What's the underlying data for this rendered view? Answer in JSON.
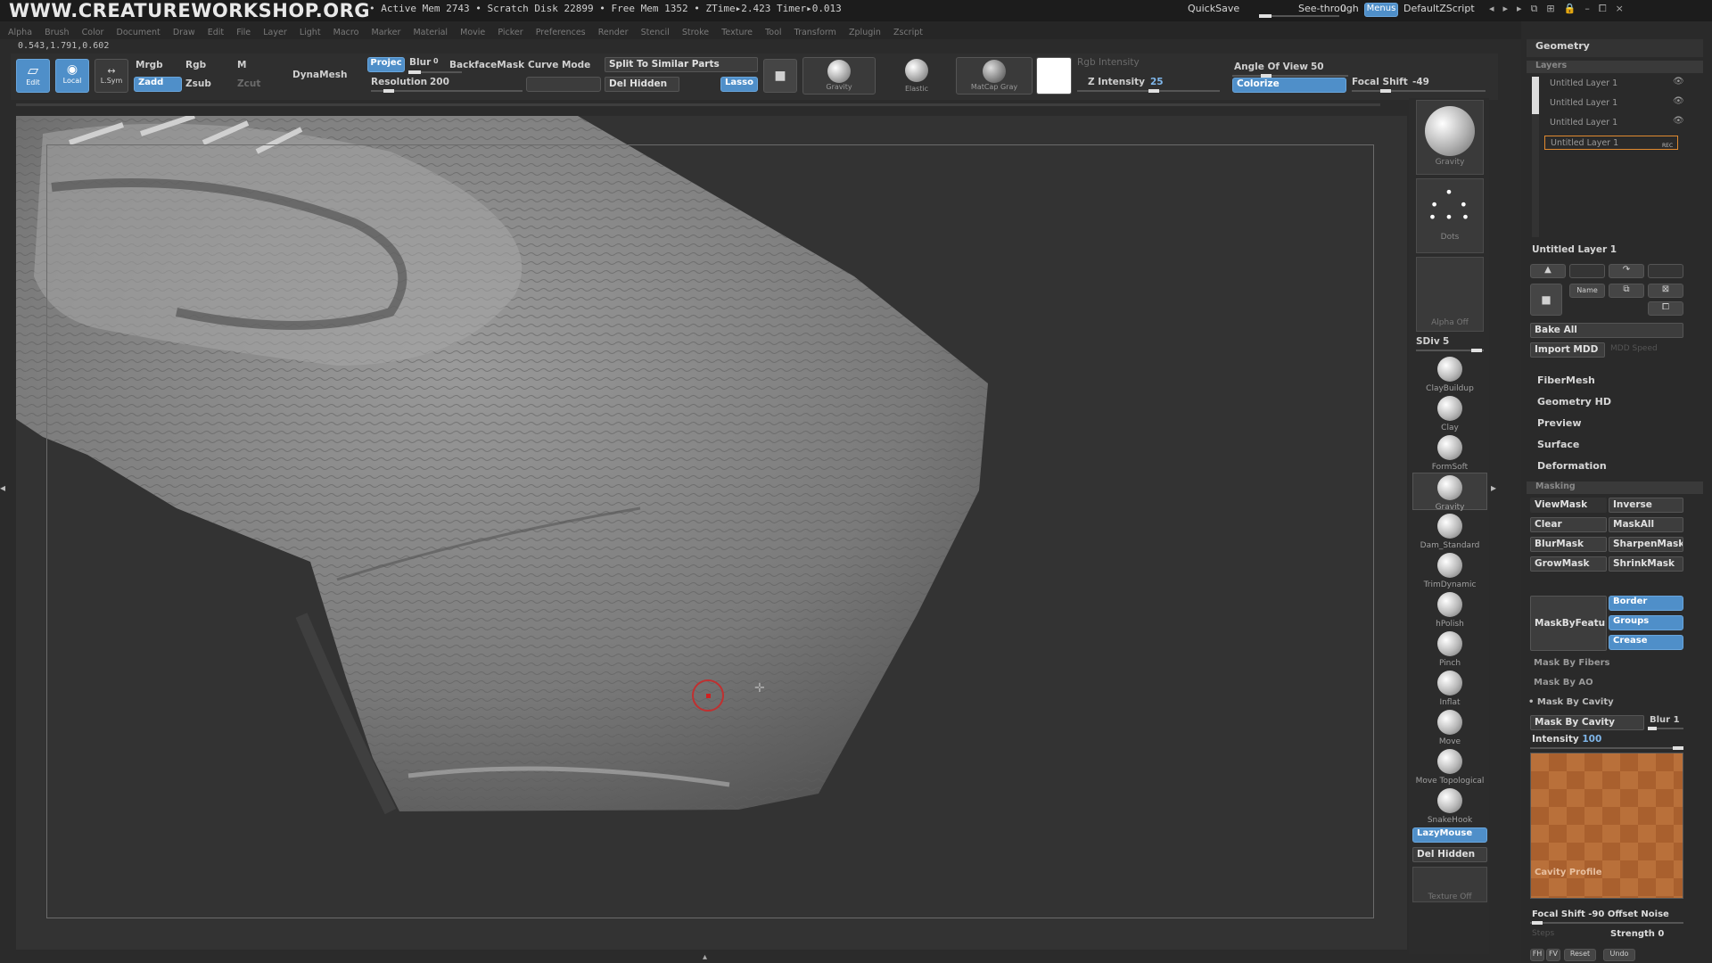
{
  "header": {
    "site": "WWW.CREATUREWORKSHOP.ORG",
    "stats": "• Active Mem 2743 • Scratch Disk 22899 • Free Mem 1352 • ZTime▸2.423 Timer▸0.013",
    "quicksave": "QuickSave",
    "see_through": "See-through",
    "see_through_value": "0",
    "menus": "Menus",
    "script": "DefaultZScript"
  },
  "menubar": [
    "Alpha",
    "Brush",
    "Color",
    "Document",
    "Draw",
    "Edit",
    "File",
    "Layer",
    "Light",
    "Macro",
    "Marker",
    "Material",
    "Movie",
    "Picker",
    "Preferences",
    "Render",
    "Stencil",
    "Stroke",
    "Texture",
    "Tool",
    "Transform",
    "Zplugin",
    "Zscript"
  ],
  "coords": "0.543,1.791,0.602",
  "toolbar": {
    "edit": "Edit",
    "local": "Local",
    "lsym": "L.Sym",
    "mrgb": "Mrgb",
    "rgb": "Rgb",
    "m": "M",
    "zadd": "Zadd",
    "zsub": "Zsub",
    "zcut": "Zcut",
    "dynamesh": "DynaMesh",
    "projec": "Projec",
    "blur": "Blur",
    "blur_value": "0",
    "backfacemask": "BackfaceMask",
    "curve_mode": "Curve Mode",
    "resolution": "Resolution",
    "resolution_value": "200",
    "split": "Split To Similar Parts",
    "del_hidden": "Del Hidden",
    "lasso": "Lasso",
    "gravity": "Gravity",
    "elastic": "Elastic",
    "matcap": "MatCap Gray",
    "rgb_intensity": "Rgb Intensity",
    "z_intensity": "Z Intensity",
    "z_intensity_value": "25",
    "angle_of_view": "Angle Of View",
    "angle_value": "50",
    "colorize": "Colorize",
    "focal_shift": "Focal Shift",
    "focal_value": "-49"
  },
  "right_shelf": {
    "gravity": "Gravity",
    "dots": "Dots",
    "alpha_off": "Alpha Off",
    "sdiv": "SDiv",
    "sdiv_value": "5",
    "brushes": [
      "ClayBuildup",
      "Clay",
      "FormSoft",
      "Gravity",
      "Dam_Standard",
      "TrimDynamic",
      "hPolish",
      "Pinch",
      "Inflat",
      "Move",
      "Move Topological",
      "SnakeHook"
    ],
    "lazymouse": "LazyMouse",
    "del_hidden": "Del Hidden",
    "texture_off": "Texture Off"
  },
  "panel": {
    "geometry": "Geometry",
    "layers": "Layers",
    "layer_items": [
      "Untitled Layer 1",
      "Untitled Layer 1",
      "Untitled Layer 1",
      "Untitled Layer 1"
    ],
    "rec": "REC",
    "current_layer": "Untitled Layer 1",
    "name": "Name",
    "bake_all": "Bake All",
    "import_mdd": "Import MDD",
    "mdd_speed": "MDD Speed",
    "sections": [
      "FiberMesh",
      "Geometry HD",
      "Preview",
      "Surface",
      "Deformation"
    ],
    "masking": "Masking",
    "viewmask": "ViewMask",
    "inverse": "Inverse",
    "clear": "Clear",
    "maskall": "MaskAll",
    "blurmask": "BlurMask",
    "sharpenmask": "SharpenMask",
    "growmask": "GrowMask",
    "shrinkmask": "ShrinkMask",
    "maskbyfeature": "MaskByFeatur",
    "border": "Border",
    "groups": "Groups",
    "crease": "Crease",
    "mask_fibers": "Mask By Fibers",
    "mask_ao": "Mask By AO",
    "mask_cavity_header": "Mask By Cavity",
    "mask_cavity": "Mask By Cavity",
    "blur": "Blur",
    "blur_value": "1",
    "intensity": "Intensity",
    "intensity_value": "100",
    "cavity_profile": "Cavity Profile",
    "focal_shift": "Focal Shift",
    "focal_value": "-90",
    "offset_noise": "Offset Noise",
    "steps": "Steps",
    "strength": "Strength",
    "strength_value": "0",
    "fh": "FH",
    "fv": "FV",
    "reset": "Reset",
    "undo": "Undo"
  },
  "colors": {
    "accent": "#4f8fc9",
    "cavity_orange": "#b9703a"
  }
}
